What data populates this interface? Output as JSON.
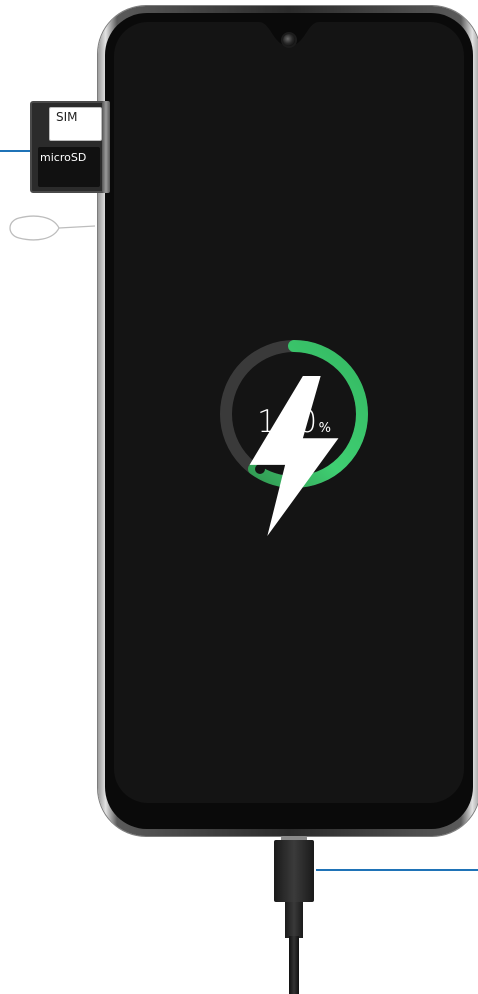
{
  "sim_tray": {
    "sim_label": "SIM",
    "sd_label": "microSD"
  },
  "charging": {
    "bolt_icon": "lightning-bolt-icon",
    "value": "100",
    "unit": "%",
    "level_fraction": 1.0,
    "colors": {
      "ring_green": "#3cc66c",
      "ring_track": "#3a3a3a",
      "screen": "#141414"
    }
  },
  "callout_color": "#1f73b7"
}
